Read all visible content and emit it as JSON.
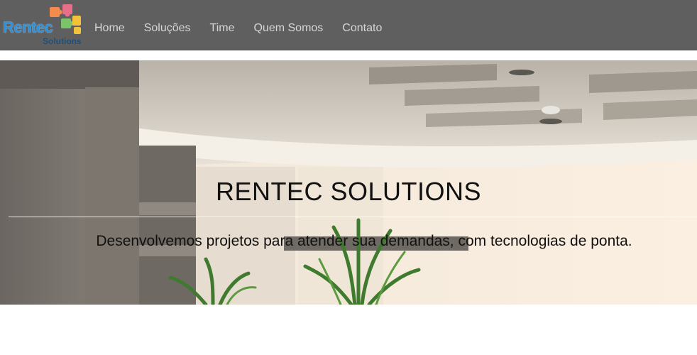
{
  "brand": {
    "name": "Rentec",
    "tagline": "Solutions"
  },
  "nav": {
    "items": [
      {
        "label": "Home"
      },
      {
        "label": "Soluções"
      },
      {
        "label": "Time"
      },
      {
        "label": "Quem Somos"
      },
      {
        "label": "Contato"
      }
    ]
  },
  "hero": {
    "title": "RENTEC SOLUTIONS",
    "subtitle": "Desenvolvemos projetos para atender sua demandas, com tecnologias de ponta."
  },
  "colors": {
    "navbar_bg": "#5f5f5f",
    "nav_text": "#d6d6d6",
    "logo_blue": "#2f8fd8",
    "puzzle_orange": "#f28b4b",
    "puzzle_green": "#7cc36b",
    "puzzle_yellow": "#f2c23a",
    "puzzle_pink": "#e86f8a"
  }
}
